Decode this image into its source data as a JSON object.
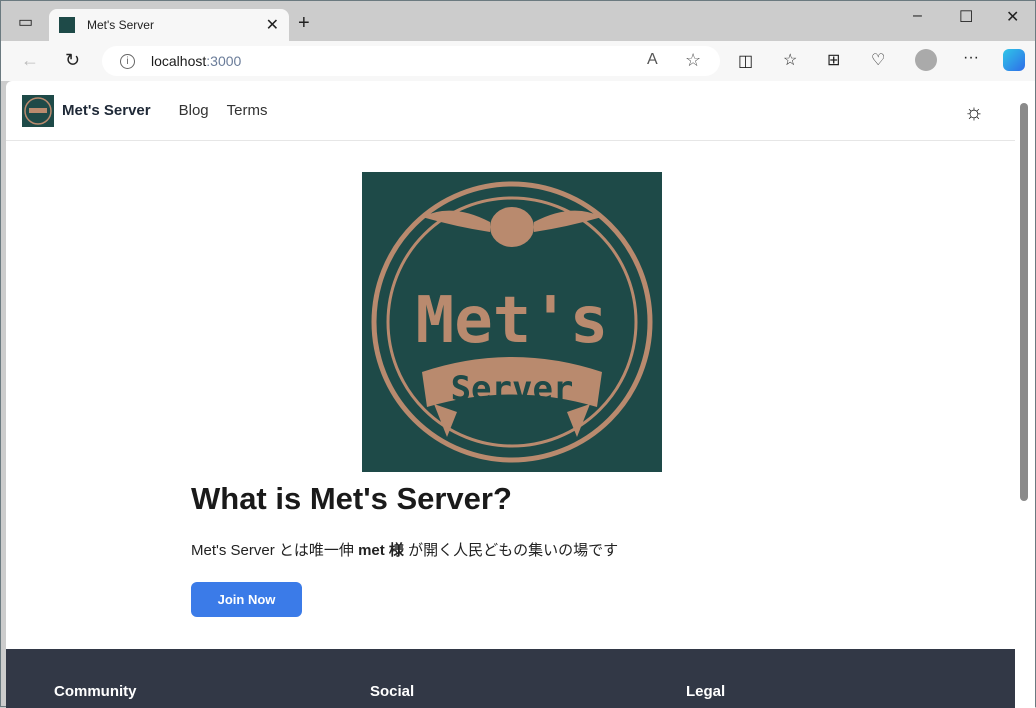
{
  "browser": {
    "tab_title": "Met's Server",
    "url_host": "localhost",
    "url_port": ":3000"
  },
  "nav": {
    "brand": "Met's Server",
    "links": [
      "Blog",
      "Terms"
    ]
  },
  "logo": {
    "text_top": "Met's",
    "text_banner": "Server",
    "colors": {
      "bg": "#1e4a48",
      "fg": "#b98a6e"
    }
  },
  "main": {
    "title": "What is Met's Server?",
    "desc_pre": "Met's Server とは唯一伸 ",
    "desc_bold": "met 様",
    "desc_post": " が開く人民どもの集いの場です",
    "join_label": "Join Now"
  },
  "footer": {
    "headings": [
      "Community",
      "Social",
      "Legal"
    ]
  },
  "colors": {
    "accent": "#3b7be8",
    "footer": "#323846"
  }
}
